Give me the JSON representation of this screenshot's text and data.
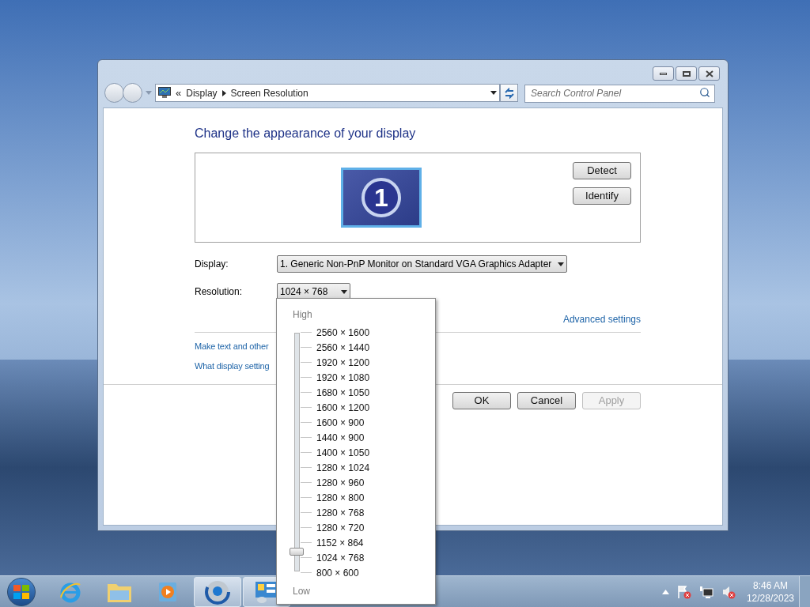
{
  "window": {
    "caption_buttons": [
      {
        "kind": "minimize"
      },
      {
        "kind": "maximize"
      },
      {
        "kind": "close"
      }
    ]
  },
  "address_bar": {
    "overflow": "«",
    "crumbs": [
      "Display",
      "Screen Resolution"
    ]
  },
  "search": {
    "placeholder": "Search Control Panel"
  },
  "heading": "Change the appearance of your display",
  "preview": {
    "monitor_number": "1",
    "buttons": [
      {
        "label": "Detect"
      },
      {
        "label": "Identify"
      }
    ]
  },
  "display_field": {
    "label": "Display:",
    "value": "1. Generic Non-PnP Monitor on Standard VGA Graphics Adapter"
  },
  "resolution_field": {
    "label": "Resolution:",
    "value": "1024 × 768"
  },
  "advanced_link": "Advanced settings",
  "links": [
    "Make text and other",
    "What display setting"
  ],
  "dialog_buttons": [
    {
      "label": "OK",
      "disabled": false
    },
    {
      "label": "Cancel",
      "disabled": false
    },
    {
      "label": "Apply",
      "disabled": true
    }
  ],
  "resolution_popup": {
    "high_label": "High",
    "low_label": "Low",
    "level": 0.0625,
    "options": [
      "2560 × 1600",
      "2560 × 1440",
      "1920 × 1200",
      "1920 × 1080",
      "1680 × 1050",
      "1600 × 1200",
      "1600 × 900",
      "1440 × 900",
      "1400 × 1050",
      "1280 × 1024",
      "1280 × 960",
      "1280 × 800",
      "1280 × 768",
      "1280 × 720",
      "1152 × 864",
      "1024 × 768",
      "800 × 600"
    ]
  },
  "taskbar": {
    "items": [
      {
        "kind": "browser-e",
        "running": false
      },
      {
        "kind": "folder",
        "running": false
      },
      {
        "kind": "media",
        "running": false
      },
      {
        "kind": "orb-browser",
        "running": true
      },
      {
        "kind": "control-panel",
        "running": true
      }
    ]
  },
  "tray": {
    "time": "8:46 AM",
    "date": "12/28/2023"
  }
}
